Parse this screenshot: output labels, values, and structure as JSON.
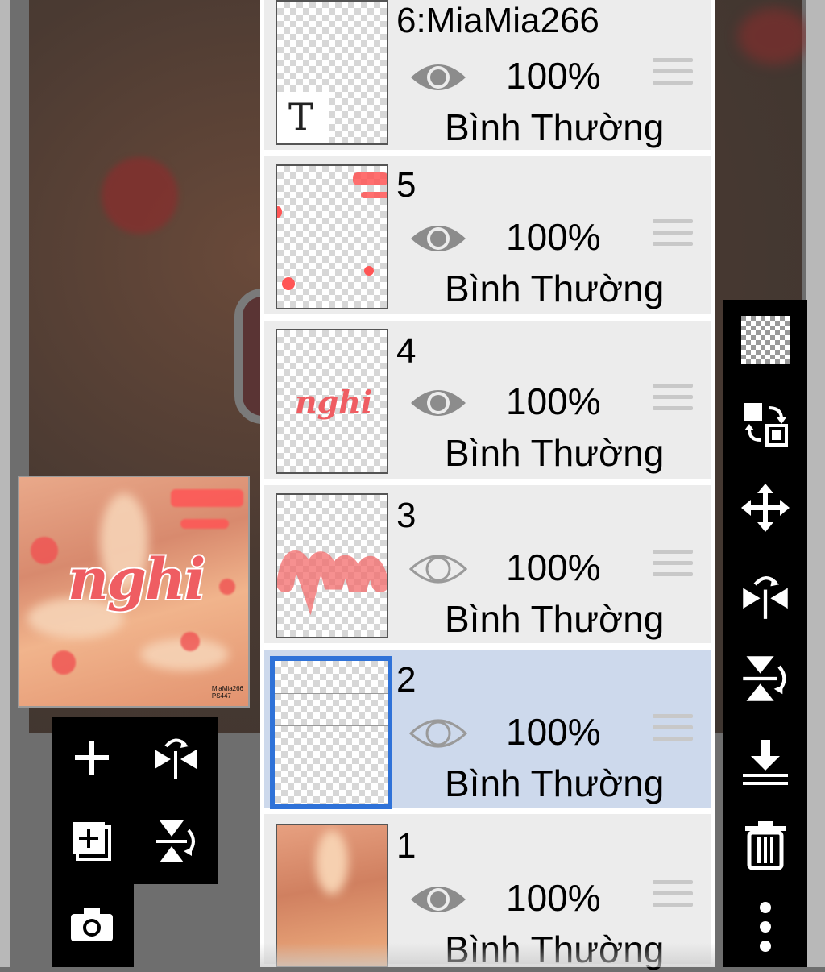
{
  "layers": [
    {
      "name": "6:MiaMia266",
      "opacity": "100%",
      "blend_mode": "Bình Thường",
      "visible": true,
      "thumb_text": "T"
    },
    {
      "name": "5",
      "opacity": "100%",
      "blend_mode": "Bình Thường",
      "visible": true
    },
    {
      "name": "4",
      "opacity": "100%",
      "blend_mode": "Bình Thường",
      "visible": true,
      "thumb_text": "nghi"
    },
    {
      "name": "3",
      "opacity": "100%",
      "blend_mode": "Bình Thường",
      "visible": false
    },
    {
      "name": "2",
      "opacity": "100%",
      "blend_mode": "Bình Thường",
      "visible": false,
      "selected": true
    },
    {
      "name": "1",
      "opacity": "100%",
      "blend_mode": "Bình Thường",
      "visible": true
    }
  ],
  "preview": {
    "title": "nghi",
    "credit": "MiaMia266\nPS447"
  },
  "colors": {
    "selected_bg": "#cdd9ec",
    "selected_border": "#2f72d8",
    "accent_red": "#ef5d62"
  },
  "left_toolbar": [
    "add-layer-icon",
    "flip-horizontal-icon",
    "add-image-layer-icon",
    "flip-vertical-icon",
    "camera-icon"
  ],
  "right_toolbar": [
    "transparency-icon",
    "swap-icon",
    "move-icon",
    "flip-horizontal-icon",
    "flip-vertical-icon",
    "merge-down-icon",
    "trash-icon",
    "more-icon"
  ]
}
